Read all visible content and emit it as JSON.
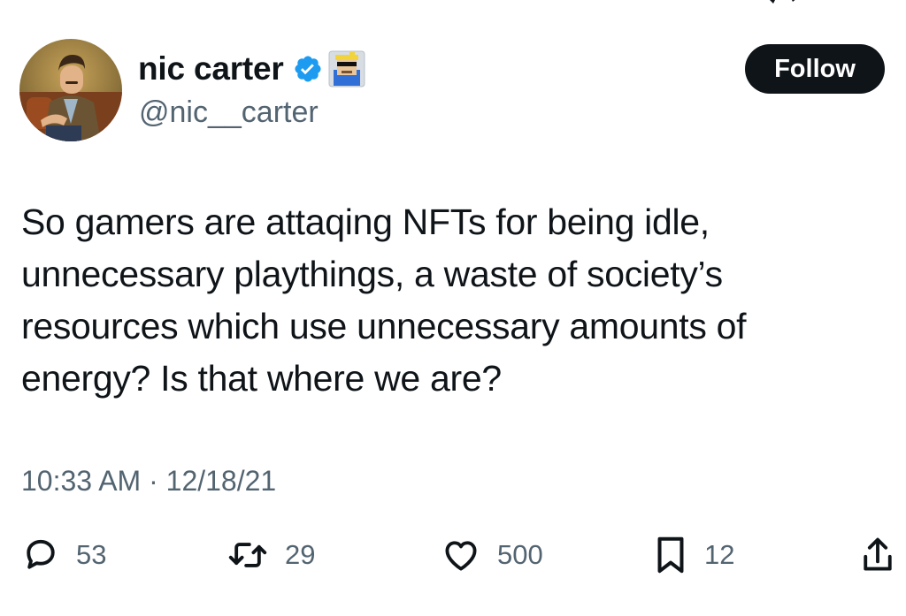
{
  "author": {
    "display_name": "nic carter",
    "handle": "@nic__carter",
    "verified": true,
    "verified_color": "#1d9bf0",
    "avatar_icon": "profile-illustration-avatar",
    "affiliate_badge_icon": "pixel-character-badge"
  },
  "follow_button": {
    "label": "Follow",
    "background": "#0f1419",
    "text_color": "#ffffff"
  },
  "tweet": {
    "lines": [
      "So gamers are attaqing NFTs for being idle,",
      "unnecessary playthings, a waste of society’s",
      "resources which use unnecessary amounts of",
      "energy? Is that where we are?"
    ],
    "time": "10:33 AM",
    "separator": "·",
    "date": "12/18/21"
  },
  "actions": {
    "replies": {
      "icon": "reply-icon",
      "count": "53"
    },
    "reposts": {
      "icon": "repost-icon",
      "count": "29"
    },
    "likes": {
      "icon": "like-icon",
      "count": "500"
    },
    "bookmarks": {
      "icon": "bookmark-icon",
      "count": "12"
    },
    "share": {
      "icon": "share-icon"
    }
  },
  "colors": {
    "text_primary": "#0f1419",
    "text_secondary": "#536471"
  }
}
